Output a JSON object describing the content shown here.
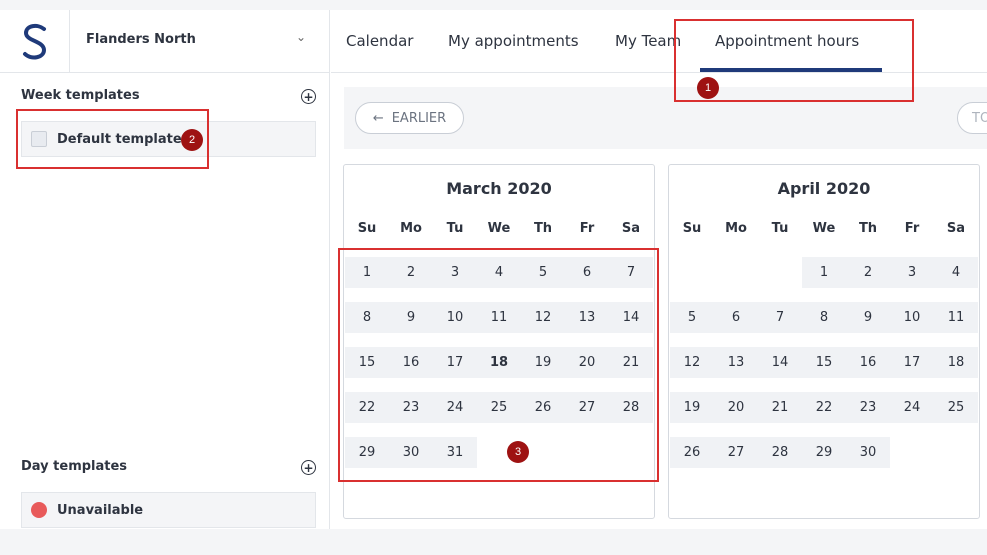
{
  "org": {
    "name": "Flanders North"
  },
  "sidebar": {
    "week_templates": {
      "title": "Week templates",
      "items": [
        {
          "label": "Default template"
        }
      ]
    },
    "day_templates": {
      "title": "Day templates",
      "items": [
        {
          "label": "Unavailable",
          "color": "#e85a5a"
        }
      ]
    }
  },
  "tabs": [
    {
      "label": "Calendar"
    },
    {
      "label": "My appointments"
    },
    {
      "label": "My Team"
    },
    {
      "label": "Appointment hours",
      "active": true
    }
  ],
  "toolbar": {
    "earlier_label": "EARLIER",
    "next_label": "TO"
  },
  "weekdays": [
    "Su",
    "Mo",
    "Tu",
    "We",
    "Th",
    "Fr",
    "Sa"
  ],
  "months": [
    {
      "title": "March 2020",
      "weeks": [
        [
          "1",
          "2",
          "3",
          "4",
          "5",
          "6",
          "7"
        ],
        [
          "8",
          "9",
          "10",
          "11",
          "12",
          "13",
          "14"
        ],
        [
          "15",
          "16",
          "17",
          "18",
          "19",
          "20",
          "21"
        ],
        [
          "22",
          "23",
          "24",
          "25",
          "26",
          "27",
          "28"
        ],
        [
          "29",
          "30",
          "31",
          "",
          "",
          "",
          ""
        ]
      ],
      "today": "18"
    },
    {
      "title": "April 2020",
      "weeks": [
        [
          "",
          "",
          "",
          "1",
          "2",
          "3",
          "4"
        ],
        [
          "5",
          "6",
          "7",
          "8",
          "9",
          "10",
          "11"
        ],
        [
          "12",
          "13",
          "14",
          "15",
          "16",
          "17",
          "18"
        ],
        [
          "19",
          "20",
          "21",
          "22",
          "23",
          "24",
          "25"
        ],
        [
          "26",
          "27",
          "28",
          "29",
          "30",
          "",
          ""
        ]
      ]
    }
  ],
  "annotations": [
    "1",
    "2",
    "3"
  ],
  "colors": {
    "accent": "#1f3a7a",
    "annotation": "#d93030",
    "badge": "#9e1212"
  }
}
